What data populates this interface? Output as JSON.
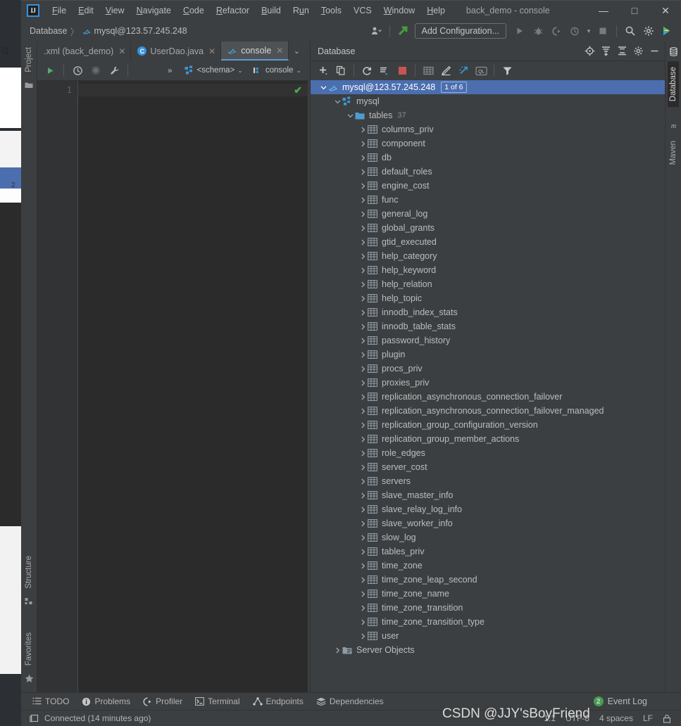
{
  "window": {
    "title": "back_demo - console",
    "logo_text": "IJ",
    "controls": {
      "minimize": "—",
      "maximize": "□",
      "close": "✕"
    }
  },
  "menubar": [
    {
      "label": "File",
      "mnemonic": "F"
    },
    {
      "label": "Edit",
      "mnemonic": "E"
    },
    {
      "label": "View",
      "mnemonic": "V"
    },
    {
      "label": "Navigate",
      "mnemonic": "N"
    },
    {
      "label": "Code",
      "mnemonic": "C"
    },
    {
      "label": "Refactor",
      "mnemonic": "R"
    },
    {
      "label": "Build",
      "mnemonic": "B"
    },
    {
      "label": "Run",
      "mnemonic": "u"
    },
    {
      "label": "Tools",
      "mnemonic": "T"
    },
    {
      "label": "VCS",
      "mnemonic": ""
    },
    {
      "label": "Window",
      "mnemonic": "W"
    },
    {
      "label": "Help",
      "mnemonic": "H"
    }
  ],
  "navbar": {
    "breadcrumbs": [
      "Database",
      "mysql@123.57.245.248"
    ],
    "separator": "〉",
    "add_configuration_label": "Add Configuration...",
    "icons": [
      "user-settings-icon",
      "updates-icon",
      "run-icon",
      "debug-icon",
      "run-coverage-icon",
      "profile-icon",
      "stop-icon",
      "search-everywhere-icon",
      "settings-gear-icon",
      "ide-assistant-icon"
    ]
  },
  "left_strip": {
    "tabs": [
      {
        "label": "Project",
        "icon": "folder-icon"
      },
      {
        "label": "Structure",
        "icon": "structure-icon"
      },
      {
        "label": "Favorites",
        "icon": "star-icon"
      }
    ]
  },
  "right_strip": {
    "tabs": [
      {
        "label": "Database",
        "icon": "database-icon",
        "active": true
      },
      {
        "label": "Maven",
        "icon": "maven-icon",
        "active": false
      }
    ]
  },
  "editor": {
    "tabs": [
      {
        "label": ".xml (back_demo)",
        "icon": "xml-file-icon",
        "active": false,
        "close": "✕"
      },
      {
        "label": "UserDao.java",
        "icon": "java-class-icon",
        "icon_letter": "C",
        "active": false,
        "close": "✕"
      },
      {
        "label": "console",
        "icon": "mysql-console-icon",
        "active": true,
        "close": "✕"
      }
    ],
    "tab_overflow": "⌄",
    "toolbar": {
      "run_label": "run-icon",
      "history_label": "history-icon",
      "stop_label": "stop-icon",
      "settings_label": "wrench-icon",
      "overflow": "»",
      "schema_chip": "<schema>",
      "session_chip": "console",
      "chevron": "⌄"
    },
    "gutter_line_number": "1",
    "inspection_status": "✔",
    "content": ""
  },
  "database_panel": {
    "title": "Database",
    "header_icons": [
      "locate-icon",
      "expand-all-icon",
      "collapse-all-icon",
      "settings-gear-icon",
      "hide-icon"
    ],
    "toolbar_icons": [
      "add-icon",
      "duplicate-icon",
      "refresh-icon",
      "sync-icon",
      "stop-icon",
      "table-editor-icon",
      "modify-icon",
      "jump-to-console-icon",
      "ql-icon",
      "filter-icon"
    ],
    "tree": {
      "connection": {
        "label": "mysql@123.57.245.248",
        "badge": "1 of 6",
        "icon": "mysql-icon",
        "expanded": true,
        "selected": true
      },
      "schema": {
        "label": "mysql",
        "icon": "schema-icon",
        "expanded": true
      },
      "tables_group": {
        "label": "tables",
        "count": "37",
        "icon": "folder-icon",
        "expanded": true
      },
      "tables": [
        "columns_priv",
        "component",
        "db",
        "default_roles",
        "engine_cost",
        "func",
        "general_log",
        "global_grants",
        "gtid_executed",
        "help_category",
        "help_keyword",
        "help_relation",
        "help_topic",
        "innodb_index_stats",
        "innodb_table_stats",
        "password_history",
        "plugin",
        "procs_priv",
        "proxies_priv",
        "replication_asynchronous_connection_failover",
        "replication_asynchronous_connection_failover_managed",
        "replication_group_configuration_version",
        "replication_group_member_actions",
        "role_edges",
        "server_cost",
        "servers",
        "slave_master_info",
        "slave_relay_log_info",
        "slave_worker_info",
        "slow_log",
        "tables_priv",
        "time_zone",
        "time_zone_leap_second",
        "time_zone_name",
        "time_zone_transition",
        "time_zone_transition_type",
        "user"
      ],
      "server_objects": {
        "label": "Server Objects",
        "icon": "server-objects-icon",
        "expanded": false
      }
    }
  },
  "bottom_tabs": [
    {
      "label": "TODO",
      "icon": "todo-icon"
    },
    {
      "label": "Problems",
      "icon": "problems-icon"
    },
    {
      "label": "Profiler",
      "icon": "profiler-icon"
    },
    {
      "label": "Terminal",
      "icon": "terminal-icon"
    },
    {
      "label": "Endpoints",
      "icon": "endpoints-icon"
    },
    {
      "label": "Dependencies",
      "icon": "dependencies-icon"
    }
  ],
  "event_log": {
    "label": "Event Log",
    "count": "2"
  },
  "statusbar": {
    "message": "Connected (14 minutes ago)",
    "icon": "console-icon",
    "caret_position": "1:1",
    "encoding": "UTF-8",
    "indent": "4 spaces",
    "line_separator": "LF",
    "lock_icon": "lock-icon"
  },
  "watermark": "CSDN @JJY'sBoyFriend",
  "background_window": {
    "cjk_text": "订"
  },
  "colors": {
    "panel_bg": "#3c3f41",
    "editor_bg": "#2b2b2b",
    "selection_blue": "#4b6eaf",
    "accent_blue": "#3592e0",
    "text": "#bbbbbb",
    "green": "#499c54",
    "red": "#c75450"
  }
}
